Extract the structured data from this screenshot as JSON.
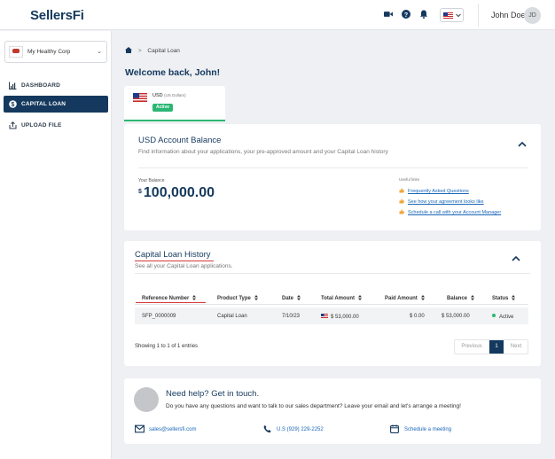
{
  "header": {
    "logo": "SellersFi",
    "user_name": "John Doe",
    "user_initials": "JD",
    "icons": [
      "video-icon",
      "help-icon",
      "bell-icon",
      "us-flag-icon",
      "chevron-down-icon"
    ]
  },
  "sidebar": {
    "company": "My Healthy Corp",
    "items": [
      {
        "label": "DASHBOARD",
        "icon": "chart-icon",
        "active": false
      },
      {
        "label": "CAPITAL LOAN",
        "icon": "dollar-icon",
        "active": true
      },
      {
        "label": "UPLOAD FILE",
        "icon": "upload-icon",
        "active": false
      }
    ]
  },
  "breadcrumb": {
    "current": "Capital Loan"
  },
  "welcome": "Welcome back, John!",
  "currency_tab": {
    "code": "USD",
    "name": "(US Dollars)",
    "status": "Active"
  },
  "balance_card": {
    "title": "USD Account Balance",
    "subtitle": "Find information about your applications, your pre-approved amount and your Capital Loan history",
    "balance_label": "Your Balance",
    "currency_symbol": "$",
    "balance": "100,000.00",
    "useful_links_label": "Useful links",
    "links": [
      "Frequently Asked Questions",
      "See how your agreement looks like",
      "Schedule a call with your Account Manager"
    ]
  },
  "history_card": {
    "title": "Capital Loan History",
    "subtitle": "See all your Capital Loan applications.",
    "columns": [
      "Reference Number",
      "Product Type",
      "Date",
      "Total Amount",
      "Paid Amount",
      "Balance",
      "Status"
    ],
    "rows": [
      {
        "ref": "SFP_0000009",
        "product": "Capital Loan",
        "date": "7/10/23",
        "total": "$ 53,000.00",
        "paid": "$ 0.00",
        "balance": "$ 53,000.00",
        "status": "Active"
      }
    ],
    "showing": "Showing 1 to 1 of 1 entries",
    "pager": {
      "previous": "Previous",
      "page": "1",
      "next": "Next"
    }
  },
  "help_card": {
    "title": "Need help? Get in touch.",
    "subtitle": "Do you have any questions and want to talk to our sales department? Leave your email and let's arrange a meeting!",
    "email": "sales@sellersfi.com",
    "phone": "U.S (929) 229-2252",
    "schedule": "Schedule a meeting"
  },
  "colors": {
    "brand": "#15395e",
    "success": "#2bb673",
    "link": "#1a67b8",
    "accent_red": "#d63a3a"
  }
}
